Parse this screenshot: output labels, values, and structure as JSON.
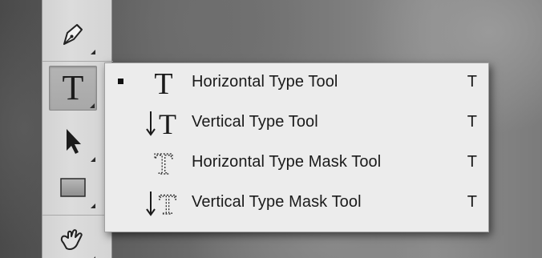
{
  "toolbar": {
    "tools": [
      {
        "name": "pen-tool",
        "icon": "pen-nib-icon"
      },
      {
        "name": "type-tool",
        "icon": "type-T-icon",
        "glyph": "T",
        "selected": true
      },
      {
        "name": "path-selection-tool",
        "icon": "arrow-pointer-icon"
      },
      {
        "name": "rectangle-tool",
        "icon": "rectangle-icon"
      },
      {
        "name": "zoom-hand-tool",
        "icon": "hand-icon"
      }
    ]
  },
  "flyout": {
    "items": [
      {
        "label": "Horizontal Type Tool",
        "shortcut": "T",
        "icon": "horizontal-type-icon",
        "glyph": "T",
        "active": true
      },
      {
        "label": "Vertical Type Tool",
        "shortcut": "T",
        "icon": "vertical-type-icon",
        "glyph": "T",
        "active": false
      },
      {
        "label": "Horizontal Type Mask Tool",
        "shortcut": "T",
        "icon": "horizontal-type-mask-icon",
        "glyph": "T",
        "active": false
      },
      {
        "label": "Vertical Type Mask Tool",
        "shortcut": "T",
        "icon": "vertical-type-mask-icon",
        "glyph": "T",
        "active": false
      }
    ]
  },
  "colors": {
    "panel": "#d8d8d8",
    "menu_bg": "#ececec",
    "text": "#1a1a1a"
  }
}
